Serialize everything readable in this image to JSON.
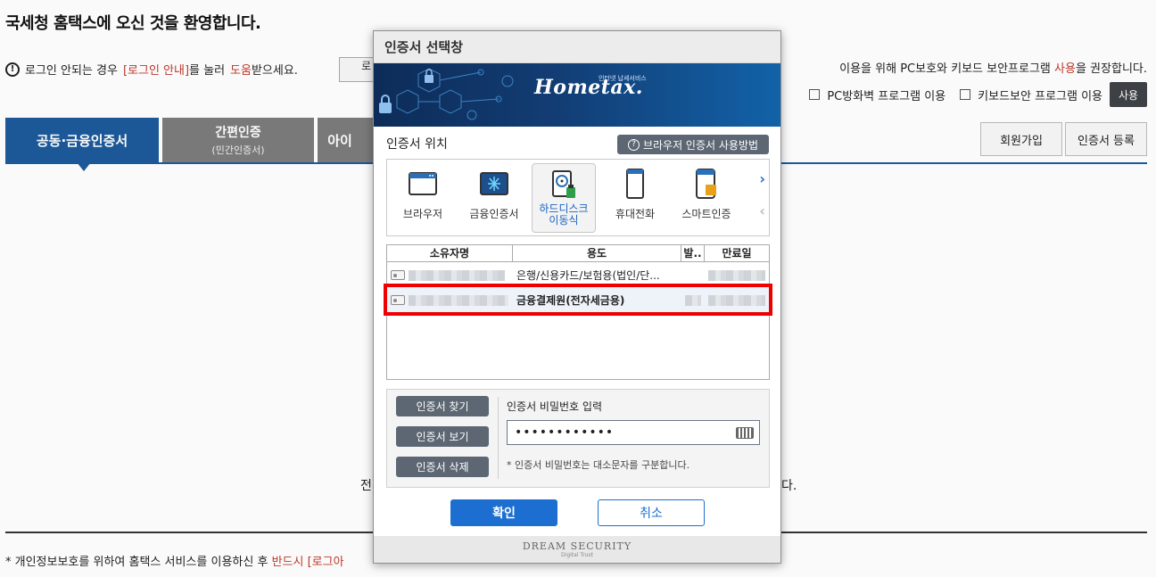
{
  "page": {
    "title": "국세청 홈택스에 오신 것을 환영합니다.",
    "login_help": {
      "prefix": "로그인 안되는 경우",
      "link": "[로그인 안내]",
      "middle": "를 눌러",
      "help_word": "도움",
      "suffix": "받으세요.",
      "guide_btn": "로"
    },
    "notice_prefix": "이용을 위해 PC보호와 키보드 보안프로그램",
    "notice_use_word": "사용",
    "notice_suffix": "을 권장합니다.",
    "checks": [
      {
        "label": "PC방화벽 프로그램 이용"
      },
      {
        "label": "키보드보안 프로그램 이용"
      }
    ],
    "use_button": "사용",
    "tabs": {
      "active": "공동·금융인증서",
      "simple": "간편인증",
      "simple_sub": "(민간인증서)",
      "id": "아이"
    },
    "join_button": "회원가입",
    "cert_register_button": "인증서 등록",
    "mid_left": "전",
    "mid_right": "다.",
    "bottom_note_prefix": "* 개인정보보호를 위하여 홈택스 서비스를 이용하신 후",
    "bottom_note_red": "반드시 [로그아"
  },
  "dialog": {
    "title": "인증서 선택창",
    "logo": "Hometax.",
    "logo_sub": "인터넷 납세서비스",
    "location_label": "인증서 위치",
    "howto_button": "브라우저 인증서 사용방법",
    "locations": [
      {
        "label": "브라우저",
        "icon": "browser-icon"
      },
      {
        "label": "금융인증서",
        "icon": "financial-cert-icon"
      },
      {
        "label": "하드디스크\n이동식",
        "label_line1": "하드디스크",
        "label_line2": "이동식",
        "icon": "harddisk-removable-icon",
        "selected": true
      },
      {
        "label": "휴대전화",
        "icon": "mobile-phone-icon"
      },
      {
        "label": "스마트인증",
        "icon": "smart-cert-icon"
      }
    ],
    "table": {
      "headers": [
        "소유자명",
        "용도",
        "발..",
        "만료일"
      ],
      "rows": [
        {
          "usage": "은행/신용카드/보험용(법인/단...",
          "selected": false
        },
        {
          "usage": "금융결제원(전자세금용)",
          "selected": true
        }
      ]
    },
    "buttons": {
      "find": "인증서 찾기",
      "view": "인증서 보기",
      "delete": "인증서 삭제",
      "ok": "확인",
      "cancel": "취소"
    },
    "password": {
      "label": "인증서 비밀번호 입력",
      "value": "••••••••••••",
      "hint": "* 인증서 비밀번호는 대소문자를 구분합니다."
    },
    "footer": {
      "brand": "DREAM SECURITY",
      "tagline": "Digital Trust"
    }
  },
  "colors": {
    "primary_blue": "#1d5a9c",
    "button_blue": "#1c6fd1",
    "highlight_red": "#ee0000",
    "gray_button": "#5d6773"
  }
}
